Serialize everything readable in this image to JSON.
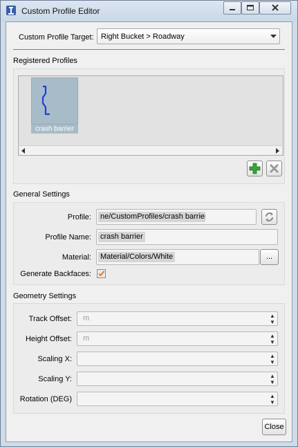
{
  "window": {
    "title": "Custom Profile Editor",
    "controls": {
      "minimize": "minimize-icon",
      "maximize": "maximize-icon",
      "close": "close-icon"
    }
  },
  "target": {
    "label": "Custom Profile Target:",
    "value": "Right Bucket > Roadway"
  },
  "registered": {
    "heading": "Registered Profiles",
    "items": [
      {
        "label": "crash barrier",
        "icon": "profile-shape-icon"
      }
    ]
  },
  "general": {
    "heading": "General Settings",
    "profile_label": "Profile:",
    "profile_value": "ne/CustomProfiles/crash barrier.sdf",
    "name_label": "Profile Name:",
    "name_value": "crash barrier",
    "material_label": "Material:",
    "material_value": "Material/Colors/White",
    "material_browse": "...",
    "backfaces_label": "Generate Backfaces:",
    "backfaces_checked": true
  },
  "geometry": {
    "heading": "Geometry Settings",
    "fields": [
      {
        "label": "Track Offset:",
        "value": "",
        "placeholder": "m"
      },
      {
        "label": "Height Offset:",
        "value": "",
        "placeholder": "m"
      },
      {
        "label": "Scaling X:",
        "value": "",
        "placeholder": ""
      },
      {
        "label": "Scaling Y:",
        "value": "",
        "placeholder": ""
      },
      {
        "label": "Rotation (DEG)",
        "value": "",
        "placeholder": ""
      }
    ]
  },
  "footer": {
    "close_label": "Close"
  },
  "colors": {
    "accent": "#3c5a9a",
    "add_green": "#2e9a2e",
    "check_orange": "#e07b2f"
  }
}
